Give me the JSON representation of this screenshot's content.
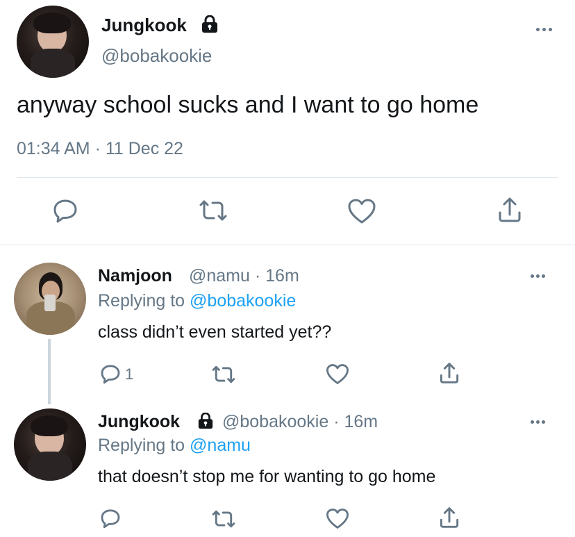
{
  "main_tweet": {
    "author_name": "Jungkook",
    "handle": "@bobakookie",
    "text": "anyway school sucks and I want to go home",
    "timestamp": "01:34 AM · 11 Dec 22",
    "locked_icon": "lock-icon",
    "actions": [
      "reply-icon",
      "retweet-icon",
      "like-icon",
      "share-icon"
    ]
  },
  "replies": [
    {
      "author_name": "Namjoon",
      "meta": "@namu · 16m",
      "replying_prefix": "Replying to ",
      "replying_handle": "@bobakookie",
      "text": "class didn’t even started yet??",
      "reply_count": "1"
    },
    {
      "author_name": "Jungkook",
      "meta": "@bobakookie · 16m",
      "replying_prefix": "Replying to ",
      "replying_handle": "@namu",
      "text": "that doesn’t stop me for wanting to go home",
      "reply_count": ""
    }
  ],
  "colors": {
    "text": "#14171a",
    "secondary": "#657786",
    "link": "#1da1f2",
    "divider": "#e1e8ed"
  }
}
